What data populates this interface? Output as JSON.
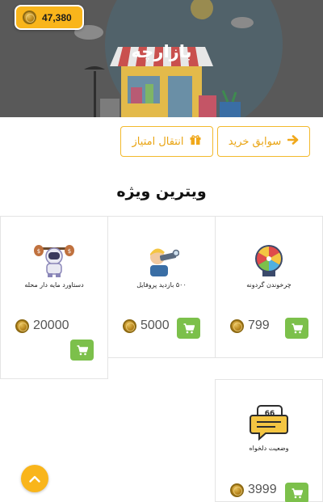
{
  "header": {
    "title": "بازارچه",
    "balance": "47,380",
    "coin_icon": "coin-icon"
  },
  "actions": {
    "history_label": "سوابق خرید",
    "history_icon": "arrow-right-icon",
    "transfer_label": "انتقال امتیاز",
    "transfer_icon": "gift-icon"
  },
  "showcase": {
    "title": "ویترین ویژه",
    "items": [
      {
        "name": "چرخوندن گردونه",
        "price": "799",
        "icon": "wheel-icon"
      },
      {
        "name": "۵۰۰ بازدید پروفایل",
        "price": "5000",
        "icon": "telescope-boy-icon"
      },
      {
        "name": "دستاورد مایه دار محله",
        "price": "20000",
        "icon": "astronaut-money-icon"
      },
      {
        "name": "وضعیت دلخواه",
        "price": "3999",
        "icon": "speech-bubble-icon"
      }
    ]
  },
  "colors": {
    "accent": "#f9b51b",
    "cart": "#7cc04b",
    "button_text": "#e9a412"
  }
}
